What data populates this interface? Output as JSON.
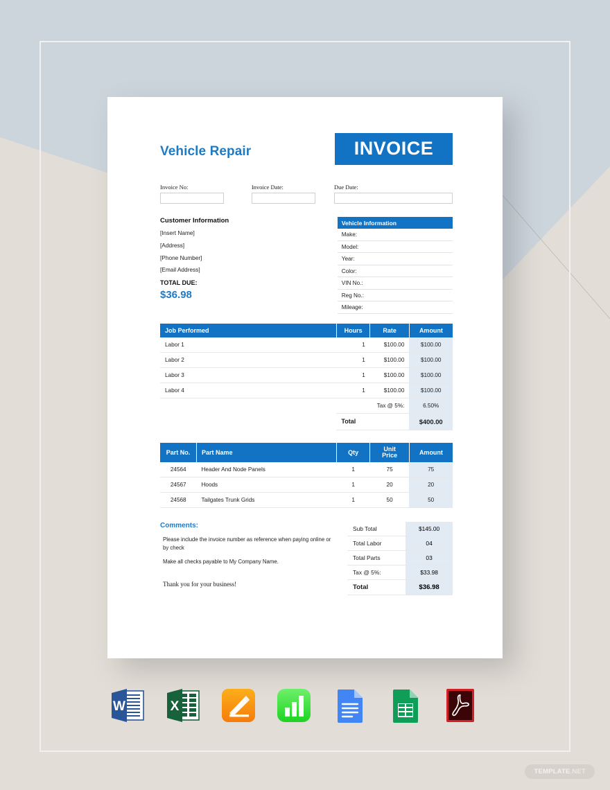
{
  "watermark": {
    "bold": "TEMPLATE",
    "light": ".NET"
  },
  "header": {
    "brand": "Vehicle Repair",
    "badge": "INVOICE"
  },
  "meta_fields": [
    {
      "label": "Invoice No:",
      "value": ""
    },
    {
      "label": "Invoice Date:",
      "value": ""
    },
    {
      "label": "Due Date:",
      "value": ""
    }
  ],
  "customer": {
    "title": "Customer Information",
    "lines": [
      "[Insert Name]",
      "[Address]",
      "[Phone Number]",
      "[Email Address]"
    ],
    "total_due_label": "TOTAL DUE:",
    "total_due_value": "$36.98"
  },
  "vehicle": {
    "title": "Vehicle Information",
    "rows": [
      "Make:",
      "Model:",
      "Year:",
      "Color:",
      "VIN No.:",
      "Reg No.:",
      "Mileage:"
    ]
  },
  "labor_table": {
    "headers": [
      "Job Performed",
      "Hours",
      "Rate",
      "Amount"
    ],
    "rows": [
      {
        "job": "Labor 1",
        "hours": "1",
        "rate": "$100.00",
        "amount": "$100.00"
      },
      {
        "job": "Labor 2",
        "hours": "1",
        "rate": "$100.00",
        "amount": "$100.00"
      },
      {
        "job": "Labor 3",
        "hours": "1",
        "rate": "$100.00",
        "amount": "$100.00"
      },
      {
        "job": "Labor 4",
        "hours": "1",
        "rate": "$100.00",
        "amount": "$100.00"
      }
    ],
    "tax_label": "Tax @ 5%:",
    "tax_value": "6.50%",
    "total_label": "Total",
    "total_value": "$400.00"
  },
  "parts_table": {
    "headers": [
      "Part No.",
      "Part Name",
      "Qty",
      "Unit Price",
      "Amount"
    ],
    "rows": [
      {
        "no": "24564",
        "name": "Header And Node Panels",
        "qty": "1",
        "unit": "75",
        "amount": "75"
      },
      {
        "no": "24567",
        "name": "Hoods",
        "qty": "1",
        "unit": "20",
        "amount": "20"
      },
      {
        "no": "24568",
        "name": "Tailgates Trunk Grids",
        "qty": "1",
        "unit": "50",
        "amount": "50"
      }
    ]
  },
  "comments": {
    "title": "Comments:",
    "paragraph1": "Please include the invoice number as reference when paying online or by check",
    "paragraph2": "Make all checks payable to My Company Name.",
    "thanks": "Thank you for your business!"
  },
  "totals": {
    "rows": [
      {
        "label": "Sub Total",
        "value": "$145.00"
      },
      {
        "label": "Total Labor",
        "value": "04"
      },
      {
        "label": "Total Parts",
        "value": "03"
      },
      {
        "label": "Tax @ 5%:",
        "value": "$33.98"
      }
    ],
    "grand_label": "Total",
    "grand_value": "$36.98"
  },
  "app_icons": [
    "microsoft-word-icon",
    "microsoft-excel-icon",
    "apple-pages-icon",
    "apple-numbers-icon",
    "google-docs-icon",
    "google-sheets-icon",
    "adobe-pdf-icon"
  ],
  "colors": {
    "accent_blue": "#1272c4",
    "brand_blue": "#1f7ac4",
    "cell_tint": "#e2eaf4",
    "bg_blue_grey": "#ccd4dc",
    "bg_beige": "#e2ddd6"
  }
}
